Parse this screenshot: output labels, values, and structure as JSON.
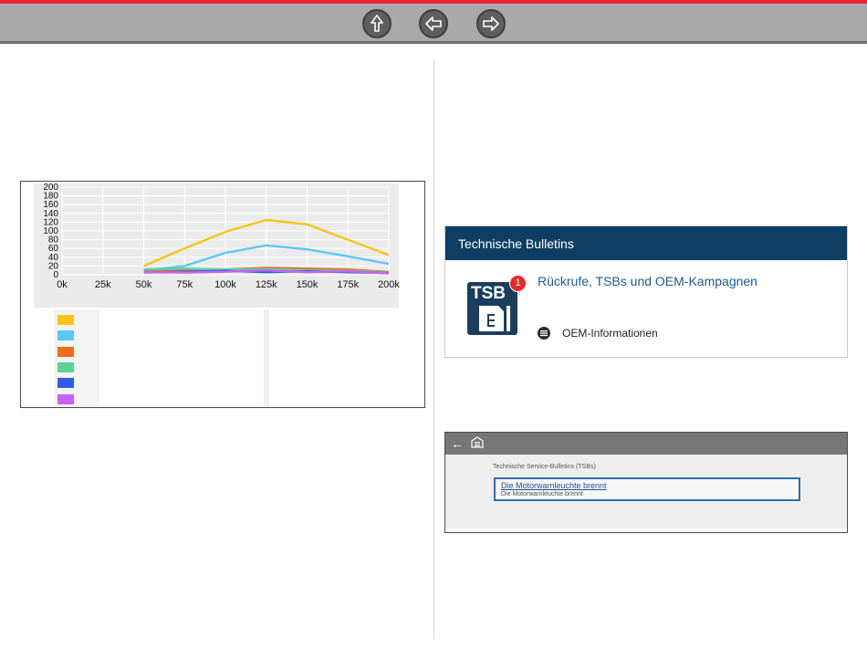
{
  "nav": {
    "up_icon": "up-arrow-icon",
    "back_icon": "left-arrow-icon",
    "forward_icon": "right-arrow-icon",
    "accent_color": "#e8223a",
    "bar_color": "#a9a9a9"
  },
  "chart_data": {
    "type": "line",
    "x": [
      "0k",
      "25k",
      "50k",
      "75k",
      "100k",
      "125k",
      "150k",
      "175k",
      "200k"
    ],
    "ylim": [
      0,
      200
    ],
    "yticks": [
      0,
      20,
      40,
      60,
      80,
      100,
      120,
      140,
      160,
      180,
      200
    ],
    "grid": true,
    "series": [
      {
        "color": "#f5c518",
        "values": [
          null,
          null,
          20,
          60,
          98,
          125,
          115,
          80,
          45
        ]
      },
      {
        "color": "#5bc8f5",
        "values": [
          null,
          null,
          10,
          20,
          50,
          67,
          58,
          42,
          25
        ]
      },
      {
        "color": "#f26b1d",
        "values": [
          null,
          null,
          8,
          10,
          12,
          16,
          14,
          12,
          6
        ]
      },
      {
        "color": "#5fcf9a",
        "values": [
          null,
          null,
          12,
          14,
          12,
          13,
          10,
          9,
          5
        ]
      },
      {
        "color": "#2f5be8",
        "values": [
          null,
          null,
          5,
          7,
          9,
          6,
          8,
          6,
          4
        ]
      },
      {
        "color": "#c563f5",
        "values": [
          null,
          null,
          6,
          5,
          7,
          10,
          6,
          8,
          3
        ]
      }
    ]
  },
  "tsb_card": {
    "header": "Technische Bulletins",
    "icon_label": "TSB",
    "badge": "1",
    "link": "Rückrufe, TSBs und OEM-Kampagnen",
    "oem_label": "OEM-Informationen",
    "header_color": "#0e3e63"
  },
  "service_screen": {
    "back_icon": "back-arrow-icon",
    "home_icon": "garage-icon",
    "title": "Technische Service-Bulletins (TSBs)",
    "item_title": "Die Motorwarnleuchte brennt",
    "item_subtitle": "Die Motorwarnleuchte brennt"
  }
}
